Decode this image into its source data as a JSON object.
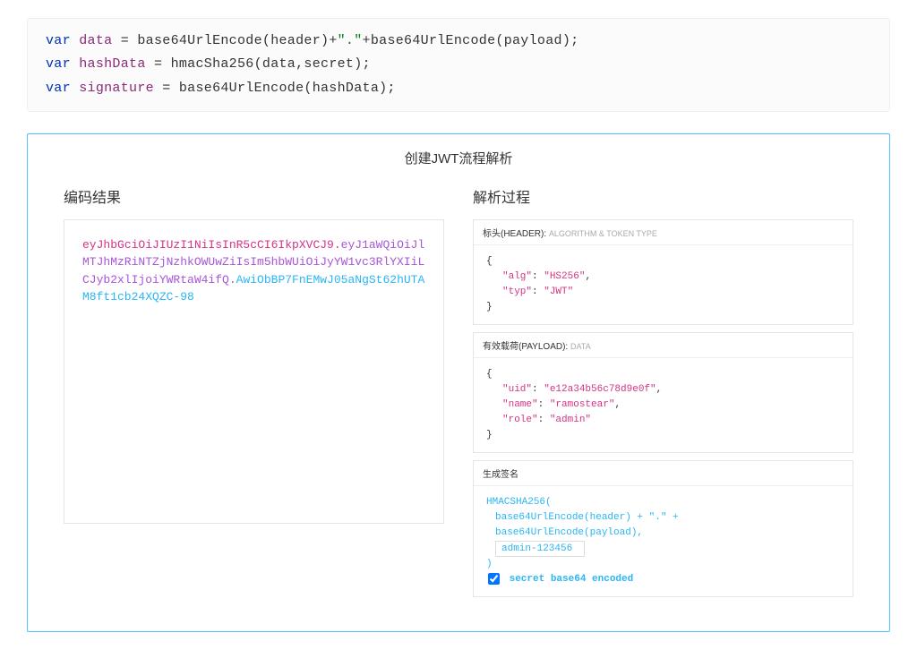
{
  "code": {
    "kw": "var",
    "line1_ident": "data",
    "line1_rhs_fn1": "base64UrlEncode",
    "line1_rhs_arg1": "header",
    "line1_rhs_str": "\".\"",
    "line1_rhs_fn2": "base64UrlEncode",
    "line1_rhs_arg2": "payload",
    "line2_ident": "hashData",
    "line2_fn": "hmacSha256",
    "line2_arg1": "data",
    "line2_arg2": "secret",
    "line3_ident": "signature",
    "line3_fn": "base64UrlEncode",
    "line3_arg": "hashData"
  },
  "diagram": {
    "title": "创建JWT流程解析",
    "left_title": "编码结果",
    "right_title": "解析过程",
    "encoded": {
      "header": "eyJhbGciOiJIUzI1NiIsInR5cCI6IkpXVCJ9",
      "dot1": ".",
      "payload": "eyJ1aWQiOiJlMTJhMzRiNTZjNzhkOWUwZiIsIm5hbWUiOiJyYW1vc3RlYXIiLCJyb2xlIjoiYWRtaW4ifQ",
      "dot2": ".",
      "sig": "AwiObBP7FnEMwJ05aNgSt62hUTAM8ft1cb24XQZC-98"
    },
    "header_panel": {
      "label": "标头(HEADER):",
      "sub": "ALGORITHM & TOKEN TYPE",
      "k1": "\"alg\"",
      "v1": "\"HS256\"",
      "k2": "\"typ\"",
      "v2": "\"JWT\""
    },
    "payload_panel": {
      "label": "有效载荷(PAYLOAD):",
      "sub": "DATA",
      "k1": "\"uid\"",
      "v1": "\"e12a34b56c78d9e0f\"",
      "k2": "\"name\"",
      "v2": "\"ramostear\"",
      "k3": "\"role\"",
      "v3": "\"admin\""
    },
    "sig_panel": {
      "label": "生成签名",
      "line1": "HMACSHA256(",
      "line2": "base64UrlEncode(header) + \".\" +",
      "line3": "base64UrlEncode(payload),",
      "secret": "admin-123456",
      "checkbox_label": "secret base64 encoded"
    }
  }
}
